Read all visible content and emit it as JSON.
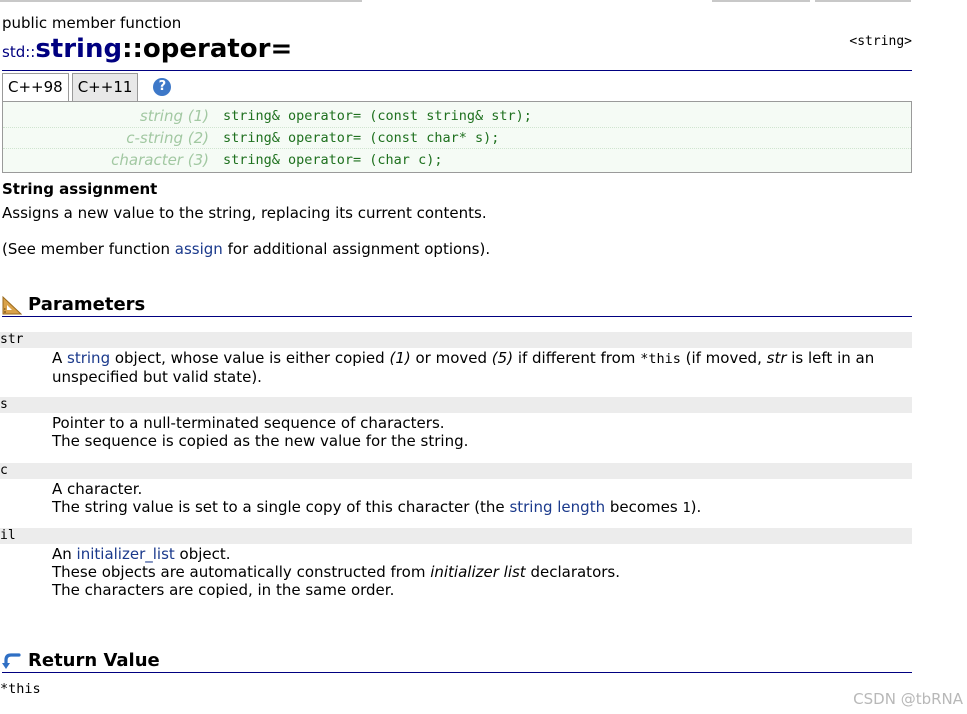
{
  "page": {
    "kind": "public member function",
    "title_ns": "std::",
    "title_class": "string",
    "title_op": "::operator=",
    "header": "<string>"
  },
  "tabs": [
    "C++98",
    "C++11"
  ],
  "help_label": "?",
  "declarations": [
    {
      "label": "string (1)",
      "code": "string& operator= (const string& str);"
    },
    {
      "label": "c-string (2)",
      "code": "string& operator= (const char* s);"
    },
    {
      "label": "character (3)",
      "code": "string& operator= (char c);"
    }
  ],
  "summary": {
    "title": "String assignment",
    "line1": "Assigns a new value to the string, replacing its current contents.",
    "see_pre": "(See member function ",
    "see_link": "assign",
    "see_post": " for additional assignment options)."
  },
  "parameters": {
    "heading": "Parameters",
    "str": {
      "name": "str",
      "p1": "A ",
      "link": "string",
      "p2": " object, whose value is either copied ",
      "p3": "(1)",
      "p4": " or moved ",
      "p5": "(5)",
      "p6": " if different from ",
      "p7": "*this",
      "p8": " (if moved, ",
      "p9": "str",
      "p10": " is left in an",
      "line2": "unspecified but valid state)."
    },
    "s": {
      "name": "s",
      "line1": "Pointer to a null-terminated sequence of characters.",
      "line2": "The sequence is copied as the new value for the string."
    },
    "c": {
      "name": "c",
      "line1": "A character.",
      "l2a": "The string value is set to a single copy of this character (the ",
      "l2link": "string length",
      "l2b": " becomes ",
      "l2num": "1",
      "l2c": ")."
    },
    "il": {
      "name": "il",
      "l1a": "An ",
      "l1link": "initializer_list",
      "l1b": " object.",
      "l2a": "These objects are automatically constructed from ",
      "l2em": "initializer list",
      "l2b": " declarators.",
      "line3": "The characters are copied, in the same order."
    }
  },
  "return_value": {
    "heading": "Return Value",
    "value": "*this"
  },
  "watermark": "CSDN @tbRNA",
  "colors": {
    "title": "#000080",
    "link": "#1b3a8c",
    "code": "#1e701e",
    "decl_label": "#a2c8a2",
    "decl_bg": "#f5fbf5",
    "param_bg": "#ececec"
  },
  "icons": {
    "parameters": "set-square-icon",
    "return_value": "return-arrow-icon",
    "help": "help-icon"
  }
}
